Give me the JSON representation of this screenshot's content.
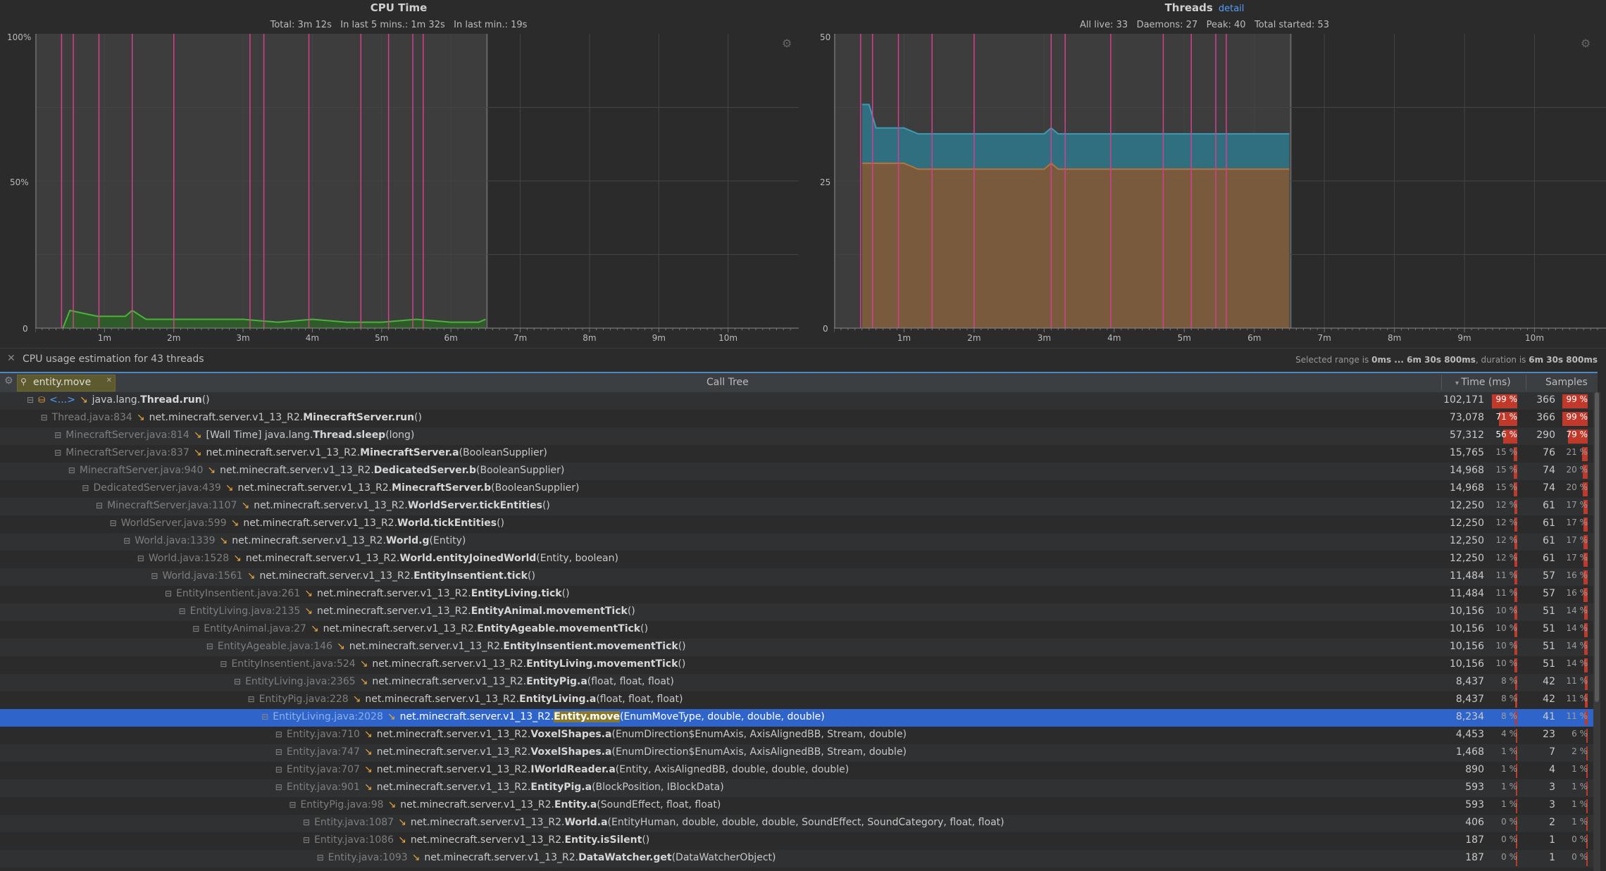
{
  "cpu_chart": {
    "title": "CPU Time",
    "summary": "Total: 3m 12s   In last 5 mins.: 1m 32s   In last min.: 19s",
    "y_ticks": [
      "100%",
      "50%",
      "0"
    ],
    "x_ticks": [
      "1m",
      "2m",
      "3m",
      "4m",
      "5m",
      "6m",
      "7m",
      "8m",
      "9m",
      "10m"
    ]
  },
  "threads_chart": {
    "title": "Threads",
    "detail_label": "detail",
    "summary": "All live: 33   Daemons: 27   Peak: 40   Total started: 53",
    "y_ticks": [
      "50",
      "25",
      "0"
    ],
    "x_ticks": [
      "1m",
      "2m",
      "3m",
      "4m",
      "5m",
      "6m",
      "7m",
      "8m",
      "9m",
      "10m"
    ]
  },
  "chart_data": [
    {
      "type": "area",
      "title": "CPU Time",
      "ylim": [
        0,
        100
      ],
      "xlim": [
        0,
        11
      ],
      "x": [
        0.4,
        0.5,
        0.9,
        1.3,
        1.4,
        1.6,
        2.0,
        2.5,
        3.0,
        3.5,
        4.0,
        4.5,
        5.0,
        5.5,
        6.0,
        6.4,
        6.5
      ],
      "series": [
        {
          "values": [
            0,
            6,
            4,
            4,
            6,
            3,
            3,
            3,
            3,
            2,
            3,
            2,
            2,
            3,
            2,
            2,
            3
          ]
        }
      ],
      "colors": {
        "line": "#4ab43a",
        "fill": "#2f5b2a"
      }
    },
    {
      "type": "area",
      "title": "Threads",
      "ylim": [
        0,
        50
      ],
      "xlim": [
        0,
        11
      ],
      "x": [
        0.4,
        0.5,
        0.6,
        1.0,
        1.2,
        2.0,
        3.0,
        3.1,
        3.2,
        4.0,
        5.0,
        6.0,
        6.5
      ],
      "series": [
        {
          "name": "All live",
          "values": [
            38,
            38,
            34,
            34,
            33,
            33,
            33,
            34,
            33,
            33,
            33,
            33,
            33
          ]
        },
        {
          "name": "Daemons",
          "values": [
            28,
            28,
            28,
            28,
            27,
            27,
            27,
            28,
            27,
            27,
            27,
            27,
            27
          ]
        }
      ],
      "colors": {
        "live": "#3d9ab6",
        "daemons": "#b7743a"
      }
    }
  ],
  "info_bar": {
    "message": "CPU usage estimation for 43 threads",
    "selected_prefix": "Selected range is ",
    "selected_range": "0ms ... 6m 30s 800ms",
    "duration_prefix": ", duration is ",
    "duration": "6m 30s 800ms"
  },
  "search": {
    "value": "entity.move"
  },
  "columns": {
    "tree": "Call Tree",
    "time": "Time (ms)",
    "samples": "Samples"
  },
  "rows": [
    {
      "indent": 0,
      "loc": "<...>",
      "pkg": "java.lang.",
      "method": "Thread.run",
      "args": "()",
      "ms": "102,171",
      "tpct": "99 %",
      "smp": "366",
      "spct": "99 %",
      "tv": 99,
      "sv": 99
    },
    {
      "indent": 1,
      "loc": "Thread.java:834",
      "pkg": "net.minecraft.server.v1_13_R2.",
      "method": "MinecraftServer.run",
      "args": "()",
      "ms": "73,078",
      "tpct": "71 %",
      "smp": "366",
      "spct": "99 %",
      "tv": 71,
      "sv": 99
    },
    {
      "indent": 2,
      "loc": "MinecraftServer.java:814",
      "pkg": "[Wall Time] java.lang.",
      "method": "Thread.sleep",
      "args": "(long)",
      "ms": "57,312",
      "tpct": "56 %",
      "smp": "290",
      "spct": "79 %",
      "tv": 56,
      "sv": 79
    },
    {
      "indent": 2,
      "loc": "MinecraftServer.java:837",
      "pkg": "net.minecraft.server.v1_13_R2.",
      "method": "MinecraftServer.a",
      "args": "(BooleanSupplier)",
      "ms": "15,765",
      "tpct": "15 %",
      "smp": "76",
      "spct": "21 %",
      "tv": 15,
      "sv": 21
    },
    {
      "indent": 3,
      "loc": "MinecraftServer.java:940",
      "pkg": "net.minecraft.server.v1_13_R2.",
      "method": "DedicatedServer.b",
      "args": "(BooleanSupplier)",
      "ms": "14,968",
      "tpct": "15 %",
      "smp": "74",
      "spct": "20 %",
      "tv": 15,
      "sv": 20
    },
    {
      "indent": 4,
      "loc": "DedicatedServer.java:439",
      "pkg": "net.minecraft.server.v1_13_R2.",
      "method": "MinecraftServer.b",
      "args": "(BooleanSupplier)",
      "ms": "14,968",
      "tpct": "15 %",
      "smp": "74",
      "spct": "20 %",
      "tv": 15,
      "sv": 20
    },
    {
      "indent": 5,
      "loc": "MinecraftServer.java:1107",
      "pkg": "net.minecraft.server.v1_13_R2.",
      "method": "WorldServer.tickEntities",
      "args": "()",
      "ms": "12,250",
      "tpct": "12 %",
      "smp": "61",
      "spct": "17 %",
      "tv": 12,
      "sv": 17
    },
    {
      "indent": 6,
      "loc": "WorldServer.java:599",
      "pkg": "net.minecraft.server.v1_13_R2.",
      "method": "World.tickEntities",
      "args": "()",
      "ms": "12,250",
      "tpct": "12 %",
      "smp": "61",
      "spct": "17 %",
      "tv": 12,
      "sv": 17
    },
    {
      "indent": 7,
      "loc": "World.java:1339",
      "pkg": "net.minecraft.server.v1_13_R2.",
      "method": "World.g",
      "args": "(Entity)",
      "ms": "12,250",
      "tpct": "12 %",
      "smp": "61",
      "spct": "17 %",
      "tv": 12,
      "sv": 17
    },
    {
      "indent": 8,
      "loc": "World.java:1528",
      "pkg": "net.minecraft.server.v1_13_R2.",
      "method": "World.entityJoinedWorld",
      "args": "(Entity, boolean)",
      "ms": "12,250",
      "tpct": "12 %",
      "smp": "61",
      "spct": "17 %",
      "tv": 12,
      "sv": 17
    },
    {
      "indent": 9,
      "loc": "World.java:1561",
      "pkg": "net.minecraft.server.v1_13_R2.",
      "method": "EntityInsentient.tick",
      "args": "()",
      "ms": "11,484",
      "tpct": "11 %",
      "smp": "57",
      "spct": "16 %",
      "tv": 11,
      "sv": 16
    },
    {
      "indent": 10,
      "loc": "EntityInsentient.java:261",
      "pkg": "net.minecraft.server.v1_13_R2.",
      "method": "EntityLiving.tick",
      "args": "()",
      "ms": "11,484",
      "tpct": "11 %",
      "smp": "57",
      "spct": "16 %",
      "tv": 11,
      "sv": 16
    },
    {
      "indent": 11,
      "loc": "EntityLiving.java:2135",
      "pkg": "net.minecraft.server.v1_13_R2.",
      "method": "EntityAnimal.movementTick",
      "args": "()",
      "ms": "10,156",
      "tpct": "10 %",
      "smp": "51",
      "spct": "14 %",
      "tv": 10,
      "sv": 14
    },
    {
      "indent": 12,
      "loc": "EntityAnimal.java:27",
      "pkg": "net.minecraft.server.v1_13_R2.",
      "method": "EntityAgeable.movementTick",
      "args": "()",
      "ms": "10,156",
      "tpct": "10 %",
      "smp": "51",
      "spct": "14 %",
      "tv": 10,
      "sv": 14
    },
    {
      "indent": 13,
      "loc": "EntityAgeable.java:146",
      "pkg": "net.minecraft.server.v1_13_R2.",
      "method": "EntityInsentient.movementTick",
      "args": "()",
      "ms": "10,156",
      "tpct": "10 %",
      "smp": "51",
      "spct": "14 %",
      "tv": 10,
      "sv": 14
    },
    {
      "indent": 14,
      "loc": "EntityInsentient.java:524",
      "pkg": "net.minecraft.server.v1_13_R2.",
      "method": "EntityLiving.movementTick",
      "args": "()",
      "ms": "10,156",
      "tpct": "10 %",
      "smp": "51",
      "spct": "14 %",
      "tv": 10,
      "sv": 14
    },
    {
      "indent": 15,
      "loc": "EntityLiving.java:2365",
      "pkg": "net.minecraft.server.v1_13_R2.",
      "method": "EntityPig.a",
      "args": "(float, float, float)",
      "ms": "8,437",
      "tpct": "8 %",
      "smp": "42",
      "spct": "11 %",
      "tv": 8,
      "sv": 11
    },
    {
      "indent": 16,
      "loc": "EntityPig.java:228",
      "pkg": "net.minecraft.server.v1_13_R2.",
      "method": "EntityLiving.a",
      "args": "(float, float, float)",
      "ms": "8,437",
      "tpct": "8 %",
      "smp": "42",
      "spct": "11 %",
      "tv": 8,
      "sv": 11
    },
    {
      "indent": 17,
      "loc": "EntityLiving.java:2028",
      "pkg": "net.minecraft.server.v1_13_R2.",
      "method": "Entity.move",
      "args": "(EnumMoveType, double, double, double)",
      "ms": "8,234",
      "tpct": "8 %",
      "smp": "41",
      "spct": "11 %",
      "tv": 8,
      "sv": 11,
      "selected": true
    },
    {
      "indent": 18,
      "loc": "Entity.java:710",
      "pkg": "net.minecraft.server.v1_13_R2.",
      "method": "VoxelShapes.a",
      "args": "(EnumDirection$EnumAxis, AxisAlignedBB, Stream, double)",
      "ms": "4,453",
      "tpct": "4 %",
      "smp": "23",
      "spct": "6 %",
      "tv": 4,
      "sv": 6
    },
    {
      "indent": 18,
      "loc": "Entity.java:747",
      "pkg": "net.minecraft.server.v1_13_R2.",
      "method": "VoxelShapes.a",
      "args": "(EnumDirection$EnumAxis, AxisAlignedBB, Stream, double)",
      "ms": "1,468",
      "tpct": "1 %",
      "smp": "7",
      "spct": "2 %",
      "tv": 1,
      "sv": 2
    },
    {
      "indent": 18,
      "loc": "Entity.java:707",
      "pkg": "net.minecraft.server.v1_13_R2.",
      "method": "IWorldReader.a",
      "args": "(Entity, AxisAlignedBB, double, double, double)",
      "ms": "890",
      "tpct": "1 %",
      "smp": "4",
      "spct": "1 %",
      "tv": 1,
      "sv": 1
    },
    {
      "indent": 18,
      "loc": "Entity.java:901",
      "pkg": "net.minecraft.server.v1_13_R2.",
      "method": "EntityPig.a",
      "args": "(BlockPosition, IBlockData)",
      "ms": "593",
      "tpct": "1 %",
      "smp": "3",
      "spct": "1 %",
      "tv": 1,
      "sv": 1
    },
    {
      "indent": 19,
      "loc": "EntityPig.java:98",
      "pkg": "net.minecraft.server.v1_13_R2.",
      "method": "Entity.a",
      "args": "(SoundEffect, float, float)",
      "ms": "593",
      "tpct": "1 %",
      "smp": "3",
      "spct": "1 %",
      "tv": 1,
      "sv": 1
    },
    {
      "indent": 20,
      "loc": "Entity.java:1087",
      "pkg": "net.minecraft.server.v1_13_R2.",
      "method": "World.a",
      "args": "(EntityHuman, double, double, double, SoundEffect, SoundCategory, float, float)",
      "ms": "406",
      "tpct": "0 %",
      "smp": "2",
      "spct": "1 %",
      "tv": 0,
      "sv": 1
    },
    {
      "indent": 20,
      "loc": "Entity.java:1086",
      "pkg": "net.minecraft.server.v1_13_R2.",
      "method": "Entity.isSilent",
      "args": "()",
      "ms": "187",
      "tpct": "0 %",
      "smp": "1",
      "spct": "0 %",
      "tv": 0,
      "sv": 0
    },
    {
      "indent": 21,
      "loc": "Entity.java:1093",
      "pkg": "net.minecraft.server.v1_13_R2.",
      "method": "DataWatcher.get",
      "args": "(DataWatcherObject)",
      "ms": "187",
      "tpct": "0 %",
      "smp": "1",
      "spct": "0 %",
      "tv": 0,
      "sv": 0
    }
  ]
}
